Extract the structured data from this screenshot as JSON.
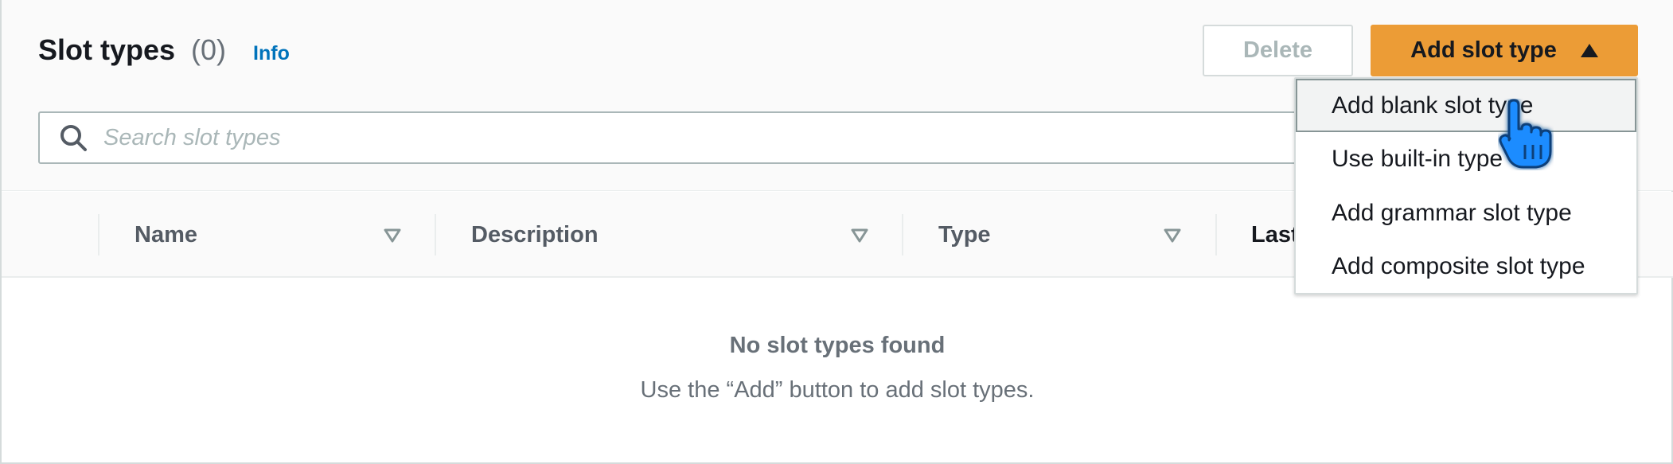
{
  "header": {
    "title": "Slot types",
    "count": "(0)",
    "info_link": "Info",
    "delete_label": "Delete",
    "add_label": "Add slot type"
  },
  "search": {
    "placeholder": "Search slot types",
    "icon": "search-icon"
  },
  "table": {
    "columns": [
      {
        "label": "Name"
      },
      {
        "label": "Description"
      },
      {
        "label": "Type"
      },
      {
        "label": "Last"
      }
    ],
    "empty_title": "No slot types found",
    "empty_description": "Use the “Add” button to add slot types."
  },
  "dropdown": {
    "items": [
      {
        "label": "Add blank slot type",
        "highlighted": true
      },
      {
        "label": "Use built-in type"
      },
      {
        "label": "Add grammar slot type"
      },
      {
        "label": "Add composite slot type"
      }
    ]
  },
  "colors": {
    "primary_button": "#ec9c36",
    "link": "#0073bb",
    "cursor": "#1a8cff"
  }
}
